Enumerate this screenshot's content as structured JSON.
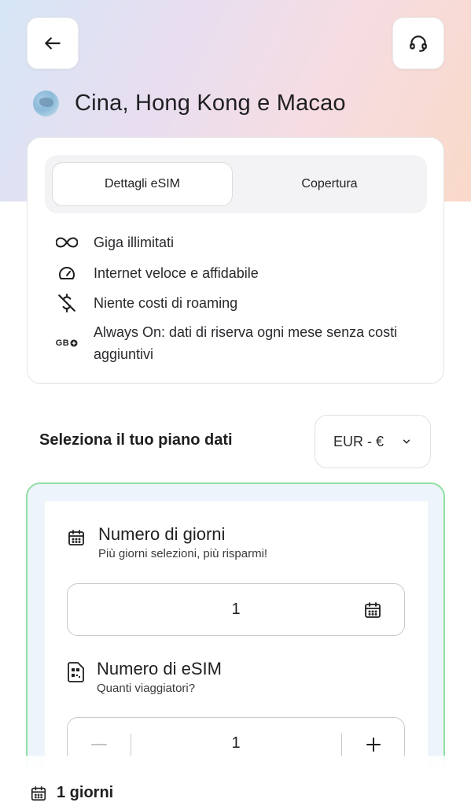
{
  "header": {
    "back_icon": "arrow-left-icon",
    "support_icon": "headset-icon",
    "title": "Cina, Hong Kong e Macao",
    "flag_icon": "globe-region-icon"
  },
  "tabs": {
    "active": "Dettagli eSIM",
    "inactive": "Copertura"
  },
  "features": [
    {
      "icon": "infinity-icon",
      "text": "Giga illimitati"
    },
    {
      "icon": "speedometer-icon",
      "text": "Internet veloce e affidabile"
    },
    {
      "icon": "no-dollar-icon",
      "text": "Niente costi di roaming"
    },
    {
      "icon": "gb-plus-icon",
      "icon_text": "GB",
      "text": "Always On: dati di riserva ogni mese senza costi aggiuntivi"
    }
  ],
  "plan": {
    "label": "Seleziona il tuo piano dati",
    "currency": "EUR - €"
  },
  "days": {
    "title": "Numero di giorni",
    "subtitle": "Più giorni selezioni, più risparmi!",
    "value": "1"
  },
  "esims": {
    "title": "Numero di eSIM",
    "subtitle": "Quanti viaggiatori?",
    "value": "1"
  },
  "footer": {
    "summary": "1 giorni"
  },
  "colors": {
    "selected_border": "#8ee0a3",
    "hero_gradient_start": "#d6e6f6",
    "hero_gradient_end": "#f9d9c8"
  }
}
